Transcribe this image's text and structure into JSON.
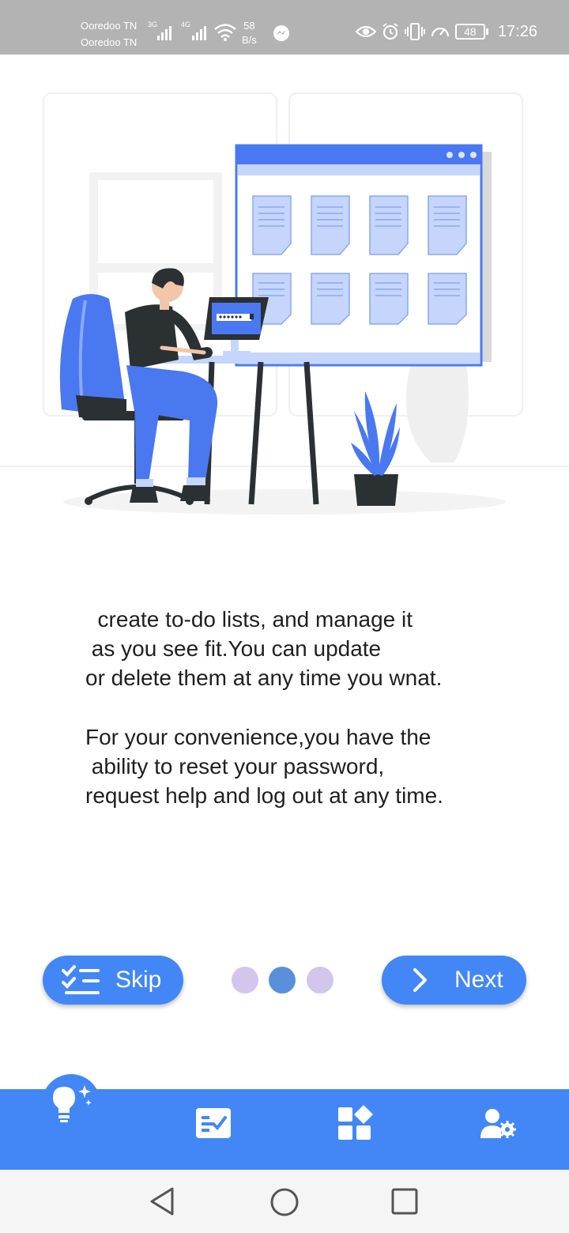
{
  "status_bar": {
    "carrier1": "Ooredoo TN",
    "carrier2": "Ooredoo TN",
    "net1": "3G",
    "net2": "4G",
    "speed_value": "58",
    "speed_unit": "B/s",
    "battery": "48",
    "time": "17:26",
    "icons": [
      "signal-icon",
      "wifi-icon",
      "messenger-icon",
      "eye-icon",
      "alarm-icon",
      "vibrate-icon",
      "speedometer-icon",
      "battery-icon"
    ]
  },
  "onboarding": {
    "paragraph1": [
      "  create to-do lists, and manage it",
      " as you see fit.You can update",
      "or delete them at any time you wnat."
    ],
    "paragraph2": [
      "For your convenience,you have the",
      " ability to reset your password,",
      "request help and log out at any time."
    ],
    "skip_label": "Skip",
    "next_label": "Next",
    "page_indicator": {
      "current": 2,
      "total": 3
    }
  },
  "bottom_nav": {
    "items": [
      "lightbulb-icon",
      "tasks-icon",
      "apps-icon",
      "user-settings-icon"
    ],
    "active": 0
  },
  "system_nav": [
    "back-icon",
    "home-icon",
    "recents-icon"
  ],
  "colors": {
    "accent": "#4287f5",
    "status_bar": "#b3b3b3",
    "dot_inactive": "#d3c6ec",
    "dot_active": "#5a8fdc",
    "illustration_blue": "#4a78f0",
    "illustration_light_blue": "#c5d5fb",
    "dark": "#2b3033"
  }
}
